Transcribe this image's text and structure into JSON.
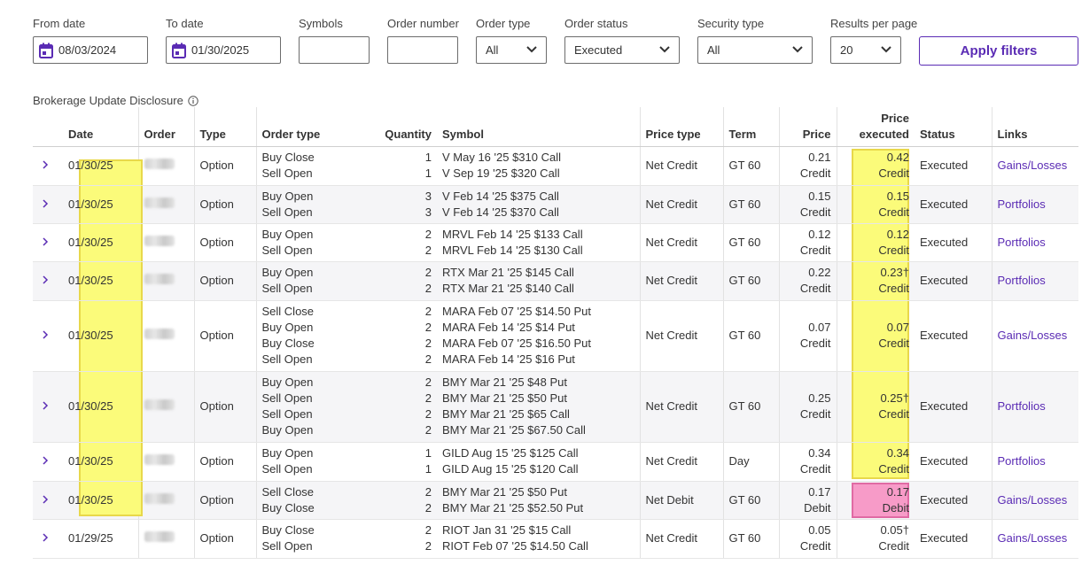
{
  "filters": {
    "from_date": {
      "label": "From date",
      "value": "08/03/2024"
    },
    "to_date": {
      "label": "To date",
      "value": "01/30/2025"
    },
    "symbols": {
      "label": "Symbols",
      "value": ""
    },
    "order_number": {
      "label": "Order number",
      "value": ""
    },
    "order_type": {
      "label": "Order type",
      "value": "All"
    },
    "order_status": {
      "label": "Order status",
      "value": "Executed"
    },
    "security_type": {
      "label": "Security type",
      "value": "All"
    },
    "results_per_page": {
      "label": "Results per page",
      "value": "20"
    },
    "apply_label": "Apply filters"
  },
  "disclosure": "Brokerage Update Disclosure",
  "colors": {
    "accent": "#5a2bb4",
    "highlight_yellow": "#fbfb7a",
    "highlight_pink": "#f79bc8"
  },
  "table": {
    "headers": {
      "date": "Date",
      "order": "Order",
      "type": "Type",
      "order_type": "Order type",
      "quantity": "Quantity",
      "symbol": "Symbol",
      "price_type": "Price type",
      "term": "Term",
      "price": "Price",
      "price_executed_1": "Price",
      "price_executed_2": "executed",
      "status": "Status",
      "links": "Links"
    },
    "rows": [
      {
        "date": "01/30/25",
        "type": "Option",
        "order_types": [
          "Buy Close",
          "Sell Open"
        ],
        "quantities": [
          "1",
          "1"
        ],
        "symbols": [
          "V May 16 '25 $310 Call",
          "V Sep 19 '25 $320 Call"
        ],
        "price_type": "Net Credit",
        "term": "GT 60",
        "price": [
          "0.21",
          "Credit"
        ],
        "price_executed": [
          "0.42",
          "Credit"
        ],
        "status": "Executed",
        "link": "Gains/Losses"
      },
      {
        "date": "01/30/25",
        "type": "Option",
        "order_types": [
          "Buy Open",
          "Sell Open"
        ],
        "quantities": [
          "3",
          "3"
        ],
        "symbols": [
          "V Feb 14 '25 $375 Call",
          "V Feb 14 '25 $370 Call"
        ],
        "price_type": "Net Credit",
        "term": "GT 60",
        "price": [
          "0.15",
          "Credit"
        ],
        "price_executed": [
          "0.15",
          "Credit"
        ],
        "status": "Executed",
        "link": "Portfolios"
      },
      {
        "date": "01/30/25",
        "type": "Option",
        "order_types": [
          "Buy Open",
          "Sell Open"
        ],
        "quantities": [
          "2",
          "2"
        ],
        "symbols": [
          "MRVL Feb 14 '25 $133 Call",
          "MRVL Feb 14 '25 $130 Call"
        ],
        "price_type": "Net Credit",
        "term": "GT 60",
        "price": [
          "0.12",
          "Credit"
        ],
        "price_executed": [
          "0.12",
          "Credit"
        ],
        "status": "Executed",
        "link": "Portfolios"
      },
      {
        "date": "01/30/25",
        "type": "Option",
        "order_types": [
          "Buy Open",
          "Sell Open"
        ],
        "quantities": [
          "2",
          "2"
        ],
        "symbols": [
          "RTX Mar 21 '25 $145 Call",
          "RTX Mar 21 '25 $140 Call"
        ],
        "price_type": "Net Credit",
        "term": "GT 60",
        "price": [
          "0.22",
          "Credit"
        ],
        "price_executed": [
          "0.23†",
          "Credit"
        ],
        "status": "Executed",
        "link": "Portfolios"
      },
      {
        "date": "01/30/25",
        "type": "Option",
        "order_types": [
          "Sell Close",
          "Buy Open",
          "Buy Close",
          "Sell Open"
        ],
        "quantities": [
          "2",
          "2",
          "2",
          "2"
        ],
        "symbols": [
          "MARA Feb 07 '25 $14.50 Put",
          "MARA Feb 14 '25 $14 Put",
          "MARA Feb 07 '25 $16.50 Put",
          "MARA Feb 14 '25 $16 Put"
        ],
        "price_type": "Net Credit",
        "term": "GT 60",
        "price": [
          "0.07",
          "Credit"
        ],
        "price_executed": [
          "0.07",
          "Credit"
        ],
        "status": "Executed",
        "link": "Gains/Losses"
      },
      {
        "date": "01/30/25",
        "type": "Option",
        "order_types": [
          "Buy Open",
          "Sell Open",
          "Sell Open",
          "Buy Open"
        ],
        "quantities": [
          "2",
          "2",
          "2",
          "2"
        ],
        "symbols": [
          "BMY Mar 21 '25 $48 Put",
          "BMY Mar 21 '25 $50 Put",
          "BMY Mar 21 '25 $65 Call",
          "BMY Mar 21 '25 $67.50 Call"
        ],
        "price_type": "Net Credit",
        "term": "GT 60",
        "price": [
          "0.25",
          "Credit"
        ],
        "price_executed": [
          "0.25†",
          "Credit"
        ],
        "status": "Executed",
        "link": "Portfolios"
      },
      {
        "date": "01/30/25",
        "type": "Option",
        "order_types": [
          "Buy Open",
          "Sell Open"
        ],
        "quantities": [
          "1",
          "1"
        ],
        "symbols": [
          "GILD Aug 15 '25 $125 Call",
          "GILD Aug 15 '25 $120 Call"
        ],
        "price_type": "Net Credit",
        "term": "Day",
        "price": [
          "0.34",
          "Credit"
        ],
        "price_executed": [
          "0.34",
          "Credit"
        ],
        "status": "Executed",
        "link": "Portfolios"
      },
      {
        "date": "01/30/25",
        "type": "Option",
        "order_types": [
          "Sell Close",
          "Buy Close"
        ],
        "quantities": [
          "2",
          "2"
        ],
        "symbols": [
          "BMY Mar 21 '25 $50 Put",
          "BMY Mar 21 '25 $52.50 Put"
        ],
        "price_type": "Net Debit",
        "term": "GT 60",
        "price": [
          "0.17",
          "Debit"
        ],
        "price_executed": [
          "0.17",
          "Debit"
        ],
        "status": "Executed",
        "link": "Gains/Losses"
      },
      {
        "date": "01/29/25",
        "type": "Option",
        "order_types": [
          "Buy Close",
          "Sell Open"
        ],
        "quantities": [
          "2",
          "2"
        ],
        "symbols": [
          "RIOT Jan 31 '25 $15 Call",
          "RIOT Feb 07 '25 $14.50 Call"
        ],
        "price_type": "Net Credit",
        "term": "GT 60",
        "price": [
          "0.05",
          "Credit"
        ],
        "price_executed": [
          "0.05†",
          "Credit"
        ],
        "status": "Executed",
        "link": "Gains/Losses"
      }
    ]
  }
}
